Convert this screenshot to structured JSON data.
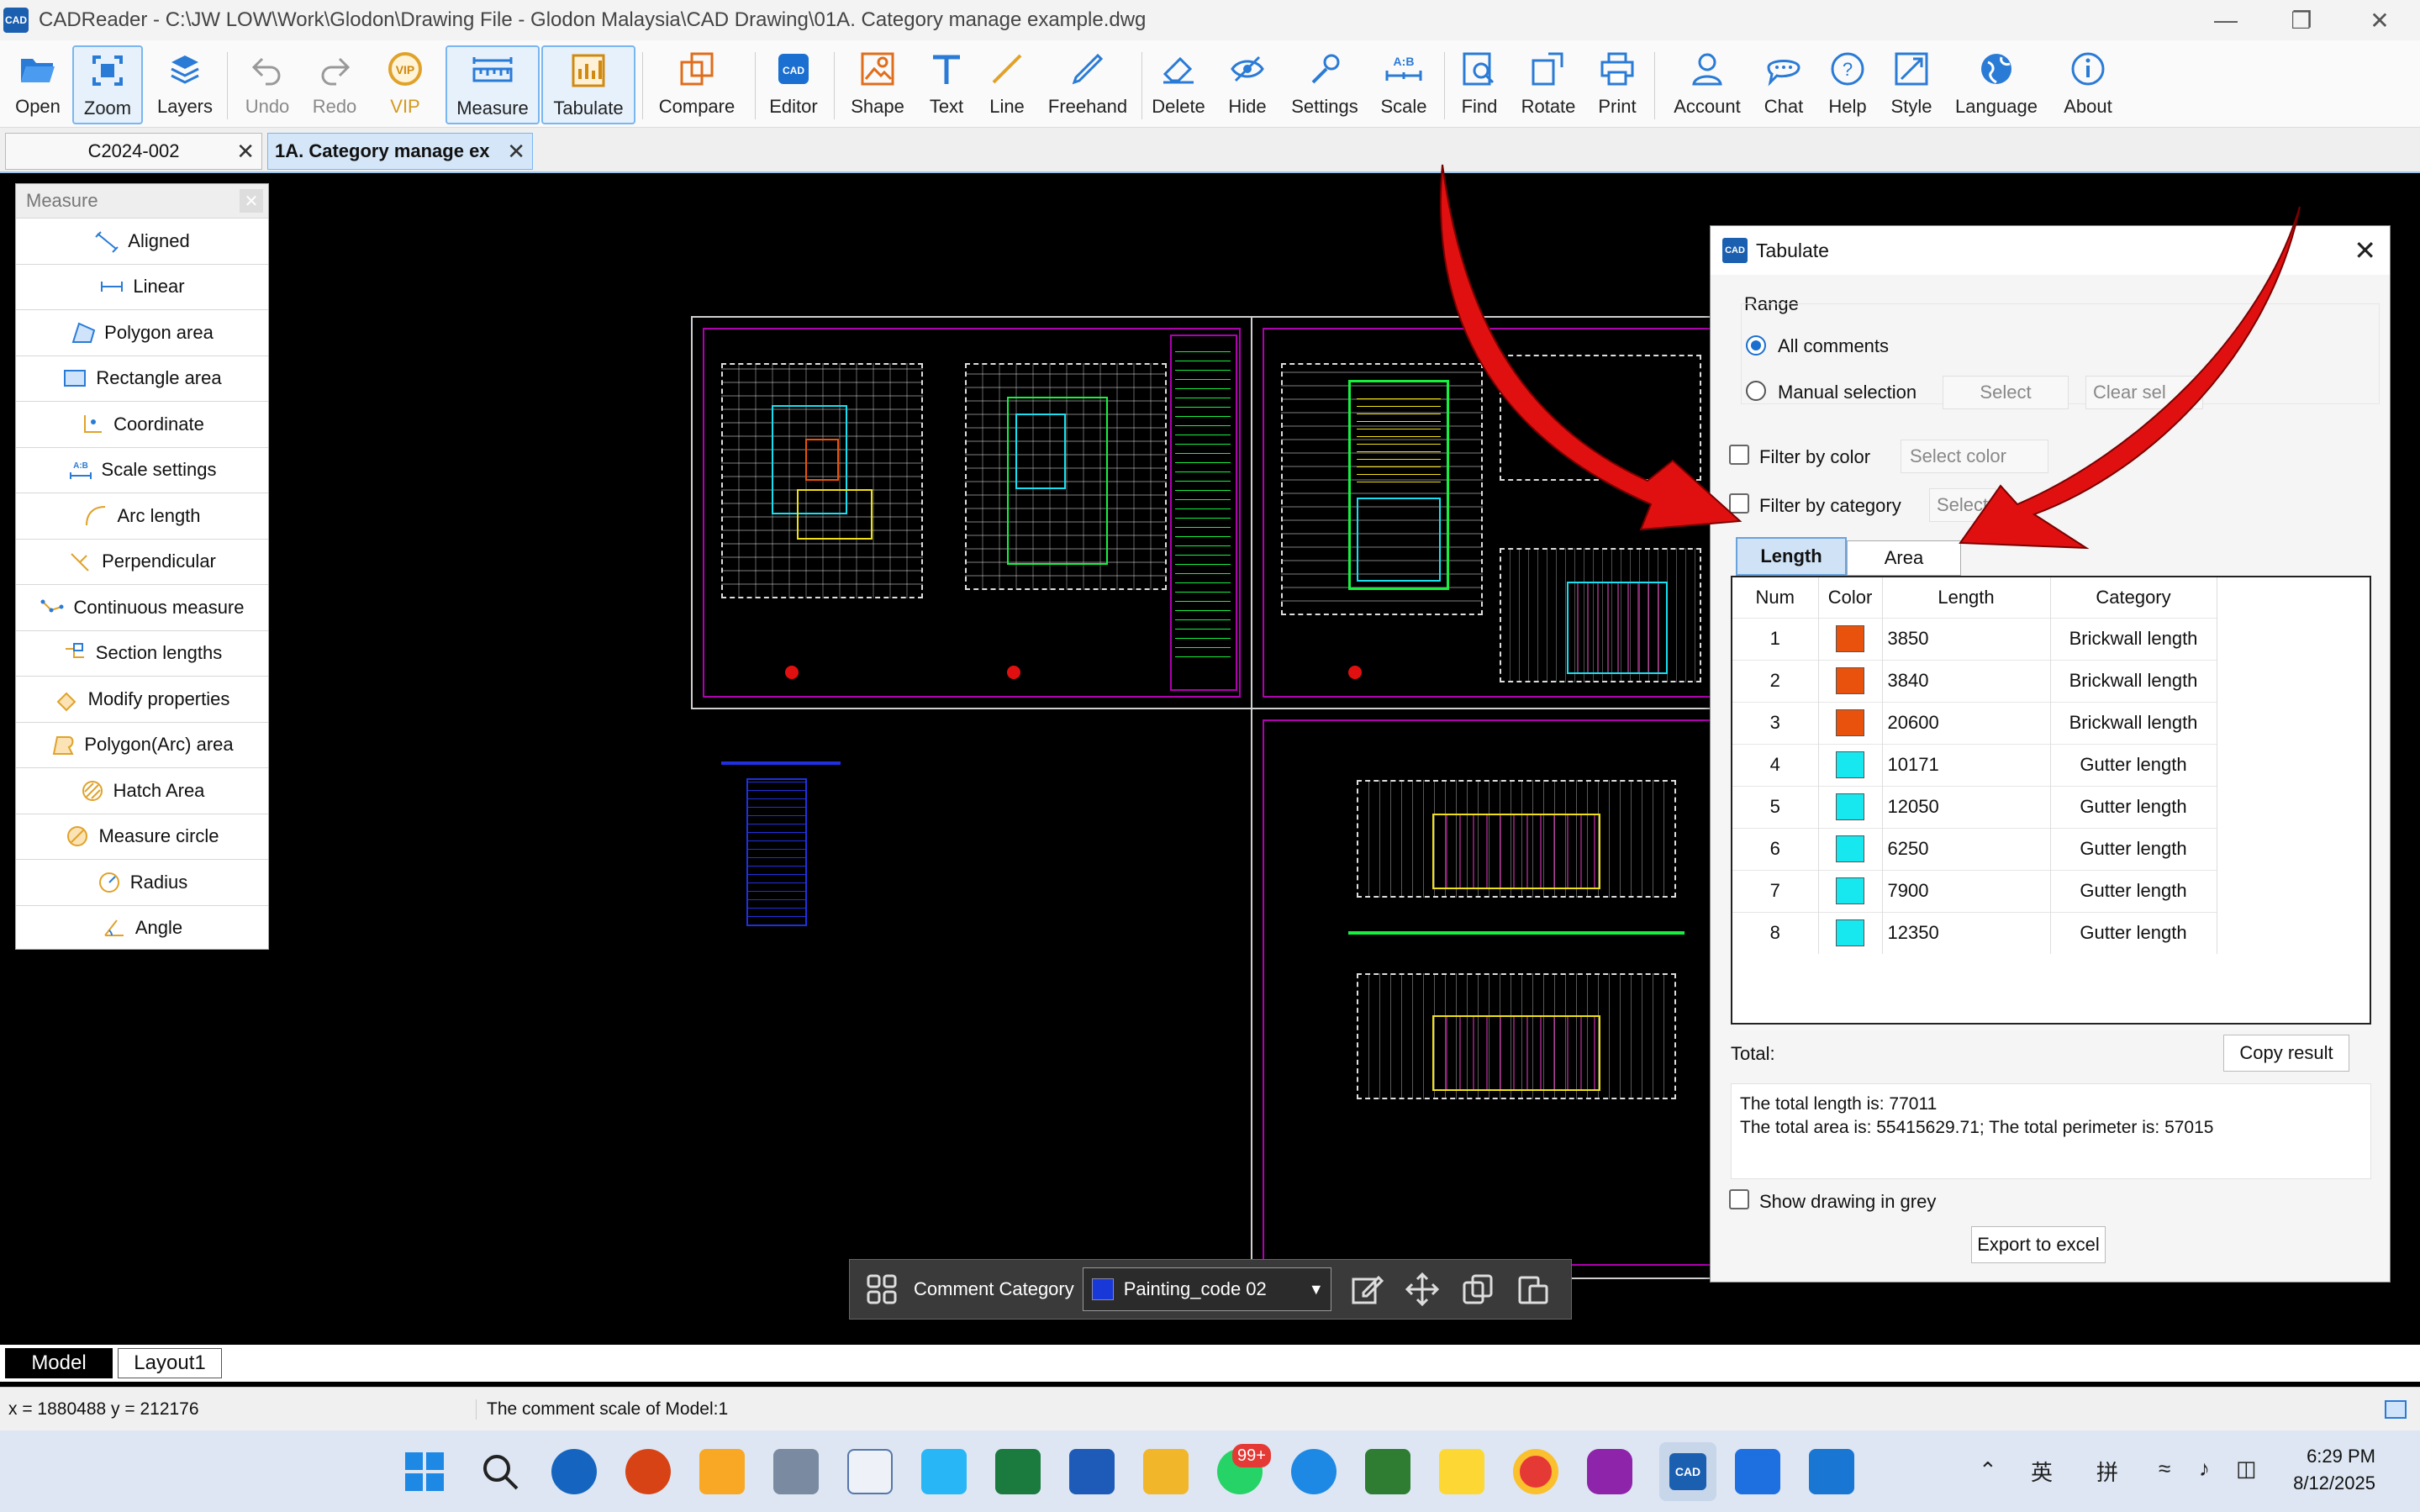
{
  "window": {
    "app_icon_text": "CAD",
    "title": "CADReader - C:\\JW LOW\\Work\\Glodon\\Drawing File - Glodon Malaysia\\CAD Drawing\\01A. Category manage example.dwg"
  },
  "ribbon": [
    {
      "label": "Open",
      "icon": "open-folder-icon"
    },
    {
      "label": "Zoom",
      "icon": "zoom-icon"
    },
    {
      "label": "Layers",
      "icon": "layers-icon"
    },
    {
      "label": "Undo",
      "icon": "undo-icon"
    },
    {
      "label": "Redo",
      "icon": "redo-icon"
    },
    {
      "label": "VIP",
      "icon": "vip-icon"
    },
    {
      "label": "Measure",
      "icon": "ruler-icon"
    },
    {
      "label": "Tabulate",
      "icon": "tabulate-icon"
    },
    {
      "label": "Compare",
      "icon": "compare-icon"
    },
    {
      "label": "Editor",
      "icon": "editor-icon"
    },
    {
      "label": "Shape",
      "icon": "shape-icon"
    },
    {
      "label": "Text",
      "icon": "text-icon"
    },
    {
      "label": "Line",
      "icon": "line-icon"
    },
    {
      "label": "Freehand",
      "icon": "pen-icon"
    },
    {
      "label": "Delete",
      "icon": "eraser-icon"
    },
    {
      "label": "Hide",
      "icon": "eye-off-icon"
    },
    {
      "label": "Settings",
      "icon": "settings-icon"
    },
    {
      "label": "Scale",
      "icon": "scale-icon"
    },
    {
      "label": "Find",
      "icon": "find-icon"
    },
    {
      "label": "Rotate",
      "icon": "rotate-icon"
    },
    {
      "label": "Print",
      "icon": "printer-icon"
    },
    {
      "label": "Account",
      "icon": "account-icon"
    },
    {
      "label": "Chat",
      "icon": "chat-icon"
    },
    {
      "label": "Help",
      "icon": "help-icon"
    },
    {
      "label": "Style",
      "icon": "style-icon"
    },
    {
      "label": "Language",
      "icon": "globe-icon"
    },
    {
      "label": "About",
      "icon": "info-icon"
    }
  ],
  "doc_tabs": [
    {
      "label": "C2024-002"
    },
    {
      "label": "1A. Category manage ex"
    }
  ],
  "measure_panel": {
    "title": "Measure",
    "items": [
      "Aligned",
      "Linear",
      "Polygon area",
      "Rectangle area",
      "Coordinate",
      "Scale settings",
      "Arc length",
      "Perpendicular",
      "Continuous measure",
      "Section lengths",
      "Modify properties",
      "Polygon(Arc) area",
      "Hatch Area",
      "Measure circle",
      "Radius",
      "Angle"
    ]
  },
  "comment_toolbar": {
    "label": "Comment Category",
    "selected": "Painting_code 02",
    "selected_color": "#1838d8"
  },
  "tabulate": {
    "title": "Tabulate",
    "range_label": "Range",
    "all_comments": "All comments",
    "manual_selection": "Manual selection",
    "select_btn": "Select",
    "clear_btn": "Clear sel",
    "filter_color": "Filter by color",
    "select_color": "Select color",
    "filter_category": "Filter by category",
    "select_category": "Select",
    "tabs": [
      "Length",
      "Area"
    ],
    "columns": [
      "Num",
      "Color",
      "Length",
      "Category"
    ],
    "rows": [
      {
        "num": "1",
        "color": "#e8520c",
        "length": "3850",
        "category": "Brickwall length"
      },
      {
        "num": "2",
        "color": "#e8520c",
        "length": "3840",
        "category": "Brickwall length"
      },
      {
        "num": "3",
        "color": "#e8520c",
        "length": "20600",
        "category": "Brickwall length"
      },
      {
        "num": "4",
        "color": "#17e8f0",
        "length": "10171",
        "category": "Gutter length"
      },
      {
        "num": "5",
        "color": "#17e8f0",
        "length": "12050",
        "category": "Gutter length"
      },
      {
        "num": "6",
        "color": "#17e8f0",
        "length": "6250",
        "category": "Gutter length"
      },
      {
        "num": "7",
        "color": "#17e8f0",
        "length": "7900",
        "category": "Gutter length"
      },
      {
        "num": "8",
        "color": "#17e8f0",
        "length": "12350",
        "category": "Gutter length"
      }
    ],
    "total_label": "Total:",
    "copy_btn": "Copy result",
    "result_line1": "The total length is: 77011",
    "result_line2": "The total area is: 55415629.71; The total perimeter is: 57015",
    "show_grey": "Show drawing in grey",
    "export_btn": "Export to excel"
  },
  "layout_tabs": [
    "Model",
    "Layout1"
  ],
  "status": {
    "coords": "x = 1880488 y = 212176",
    "message": "The comment scale of Model:1"
  },
  "taskbar": {
    "badge": "99+",
    "ime1": "英",
    "ime2": "拼",
    "time": "6:29 PM",
    "date": "8/12/2025"
  },
  "colors": {
    "annotation_arrow": "#e01010",
    "cad_magenta": "#b000b0",
    "accent": "#1a6fd0"
  }
}
